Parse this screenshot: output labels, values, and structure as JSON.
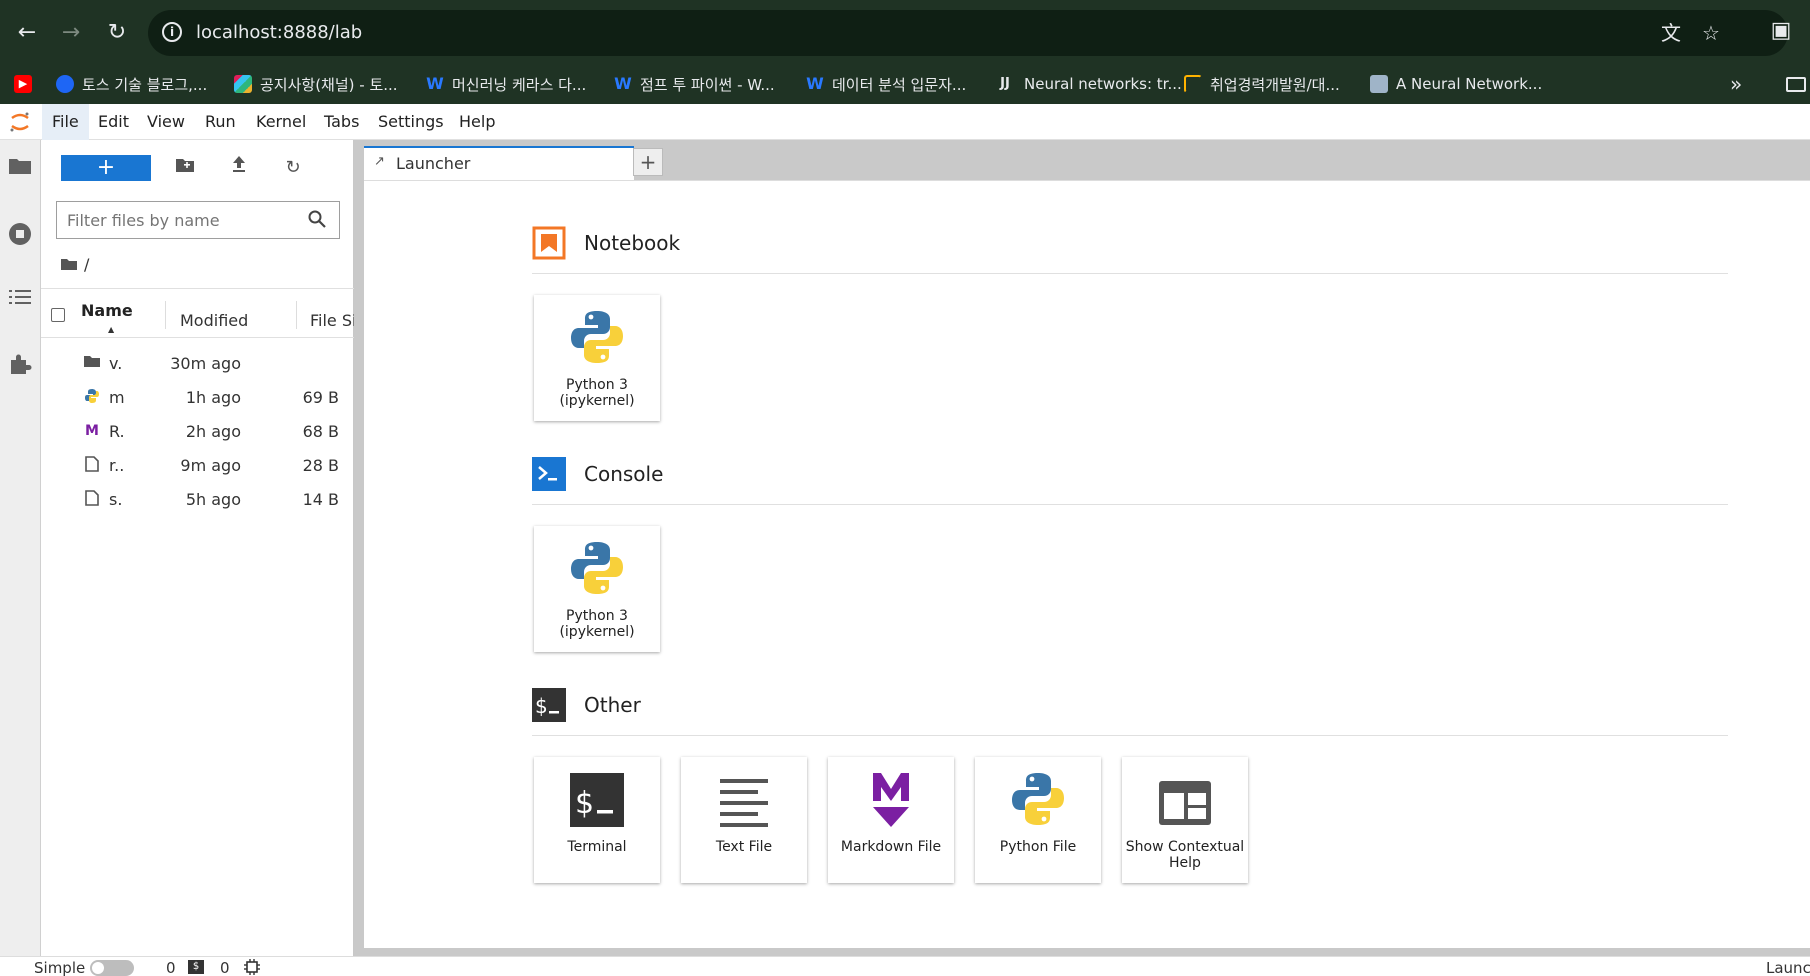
{
  "browser": {
    "url": "localhost:8888/lab",
    "bookmarks": [
      {
        "label": "",
        "icon": "youtube-icon"
      },
      {
        "label": "토스 기술 블로그,...",
        "icon": "toss-icon"
      },
      {
        "label": "공지사항(채널) - 토...",
        "icon": "slack-icon"
      },
      {
        "label": "머신러닝 케라스 다...",
        "icon": "wikidocs-icon"
      },
      {
        "label": "점프 투 파이썬 - W...",
        "icon": "wikidocs-icon"
      },
      {
        "label": "데이터 분석 입문자...",
        "icon": "wikidocs-icon"
      },
      {
        "label": "Neural networks: tr...",
        "icon": "jj-icon"
      },
      {
        "label": "취업경력개발원/대...",
        "icon": "career-icon"
      },
      {
        "label": "A Neural Network...",
        "icon": "globe-icon"
      }
    ]
  },
  "menubar": {
    "items": [
      "File",
      "Edit",
      "View",
      "Run",
      "Kernel",
      "Tabs",
      "Settings",
      "Help"
    ]
  },
  "filebrowser": {
    "new_label": "+",
    "filter_placeholder": "Filter files by name",
    "breadcrumb": "/",
    "columns": {
      "name": "Name",
      "modified": "Modified",
      "size": "File Si"
    },
    "files": [
      {
        "name": "v.",
        "modified": "30m ago",
        "size": "",
        "type": "folder"
      },
      {
        "name": "m",
        "modified": "1h ago",
        "size": "69 B",
        "type": "python"
      },
      {
        "name": "R.",
        "modified": "2h ago",
        "size": "68 B",
        "type": "markdown"
      },
      {
        "name": "r..",
        "modified": "9m ago",
        "size": "28 B",
        "type": "file"
      },
      {
        "name": "s.",
        "modified": "5h ago",
        "size": "14 B",
        "type": "file"
      }
    ]
  },
  "tabs": [
    {
      "label": "Launcher"
    }
  ],
  "launcher": {
    "sections": {
      "notebook": "Notebook",
      "console": "Console",
      "other": "Other"
    },
    "notebook_cards": [
      {
        "label": "Python 3 (ipykernel)"
      }
    ],
    "console_cards": [
      {
        "label": "Python 3 (ipykernel)"
      }
    ],
    "other_cards": [
      {
        "label": "Terminal"
      },
      {
        "label": "Text File"
      },
      {
        "label": "Markdown File"
      },
      {
        "label": "Python File"
      },
      {
        "label": "Show Contextual Help"
      }
    ]
  },
  "statusbar": {
    "mode": "Simple",
    "terminals": "0",
    "kernels": "0",
    "right": "Launc"
  },
  "colors": {
    "chrome_bg": "#1f3324",
    "accent": "#1976d2",
    "notebook_orange": "#f37726",
    "markdown_purple": "#7b1fa2"
  }
}
